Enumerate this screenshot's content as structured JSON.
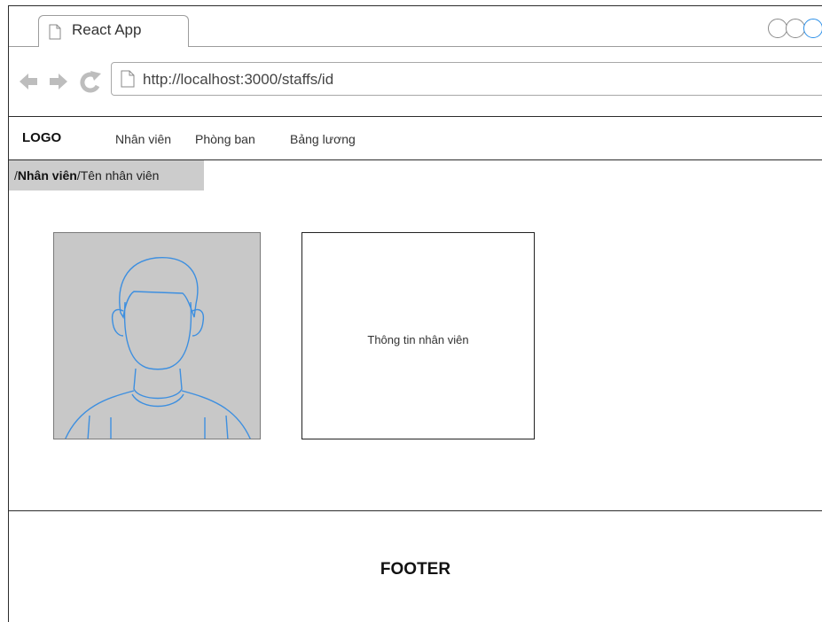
{
  "browser": {
    "tab_title": "React App",
    "url": "http://localhost:3000/staffs/id",
    "icons": [
      "back-arrow-icon",
      "forward-arrow-icon",
      "refresh-icon",
      "document-icon"
    ]
  },
  "header": {
    "logo": "LOGO",
    "nav": [
      "Nhân viên",
      "Phòng ban",
      "Bảng lương"
    ]
  },
  "breadcrumb": {
    "separator": "/",
    "parent": "Nhân viên",
    "current": "Tên nhân viên"
  },
  "staff": {
    "info_placeholder": "Thông tin nhân viên"
  },
  "footer": {
    "label": "FOOTER"
  },
  "colors": {
    "placeholder_gray": "#c8c8c8",
    "avatar_stroke": "#3d8fe0",
    "window_circle_accent": "#2b8fe8"
  }
}
